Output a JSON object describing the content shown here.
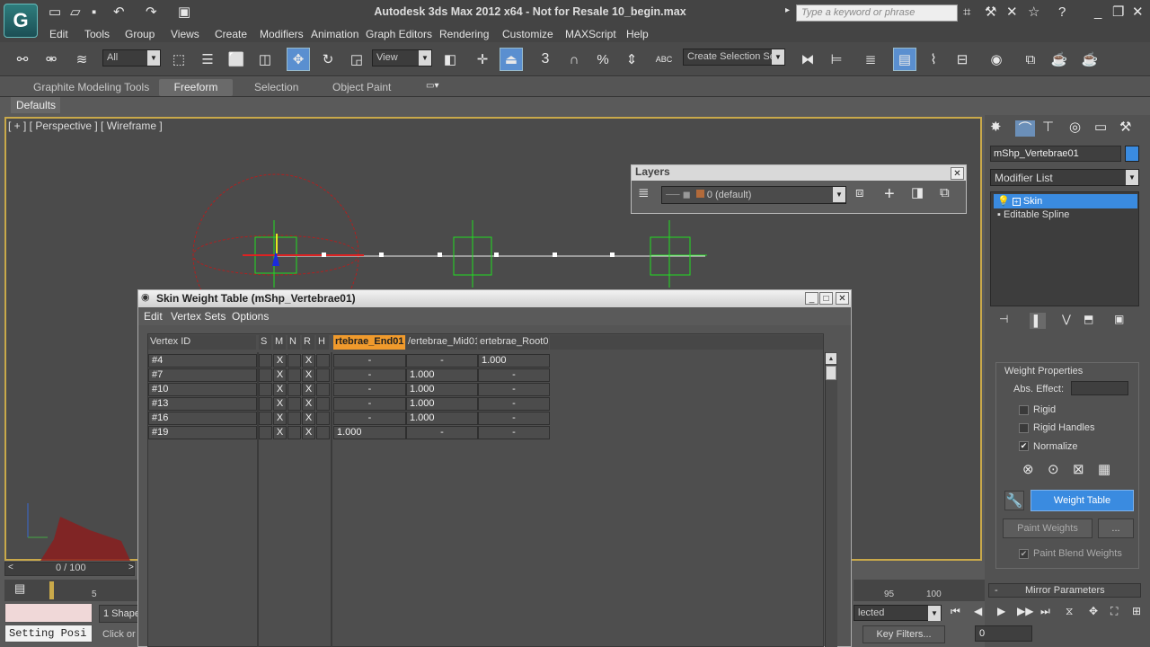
{
  "app": {
    "logo_glyph": "G",
    "title": "Autodesk 3ds Max  2012 x64  - Not for Resale   10_begin.max",
    "search_placeholder": "Type a keyword or phrase"
  },
  "menu": [
    "Edit",
    "Tools",
    "Group",
    "Views",
    "Create",
    "Modifiers",
    "Animation",
    "Graph Editors",
    "Rendering",
    "Customize",
    "MAXScript",
    "Help"
  ],
  "toolbar": {
    "selection_filter": "All",
    "ref_coord": "View",
    "named_selection": "Create Selection Se",
    "snap_3": "3",
    "snap_pct": "%",
    "abc": "ABC"
  },
  "ribbon": {
    "tabs": [
      "Graphite Modeling Tools",
      "Freeform",
      "Selection",
      "Object Paint"
    ],
    "active": "Freeform",
    "defaults": "Defaults"
  },
  "viewport": {
    "label": "[ + ] [ Perspective ] [ Wireframe ]",
    "accent": "#c9a94a"
  },
  "layers": {
    "title": "Layers",
    "current_layer": "0 (default)"
  },
  "command_panel": {
    "object_name": "mShp_Vertebrae01",
    "object_color": "#3a8be0",
    "modifier_list": "Modifier List",
    "stack": [
      "Skin",
      "Editable Spline"
    ],
    "weight_properties": "Weight Properties",
    "abs_effect": "Abs. Effect:",
    "rigid": "Rigid",
    "rigid_handles": "Rigid Handles",
    "normalize": "Normalize",
    "weight_table": "Weight Table",
    "paint_weights": "Paint Weights",
    "ellipsis": "...",
    "paint_blend": "Paint Blend Weights",
    "mirror_params": "Mirror Parameters",
    "minus": "-"
  },
  "skin_table": {
    "title": "Skin Weight Table (mShp_Vertebrae01)",
    "menu": [
      "Edit",
      "Vertex Sets",
      "Options"
    ],
    "headers": {
      "vertex_id": "Vertex ID",
      "s": "S",
      "m": "M",
      "n": "N",
      "r": "R",
      "h": "H"
    },
    "bones": [
      "rtebrae_End01",
      "/ertebrae_Mid01",
      "ertebrae_Root01"
    ],
    "rows": [
      {
        "id": "#4",
        "m": "X",
        "r": "X",
        "w": [
          "-",
          "-",
          "1.000"
        ]
      },
      {
        "id": "#7",
        "m": "X",
        "r": "X",
        "w": [
          "-",
          "1.000",
          "-"
        ]
      },
      {
        "id": "#10",
        "m": "X",
        "r": "X",
        "w": [
          "-",
          "1.000",
          "-"
        ]
      },
      {
        "id": "#13",
        "m": "X",
        "r": "X",
        "w": [
          "-",
          "1.000",
          "-"
        ]
      },
      {
        "id": "#16",
        "m": "X",
        "r": "X",
        "w": [
          "-",
          "1.000",
          "-"
        ]
      },
      {
        "id": "#19",
        "m": "X",
        "r": "X",
        "w": [
          "1.000",
          "-",
          "-"
        ]
      }
    ]
  },
  "bottom": {
    "frame": "0 / 100",
    "tick_5": "5",
    "tick_95": "95",
    "tick_100": "100",
    "shapes": "1 Shape",
    "click_or": "Click or",
    "status": "Setting Posi",
    "selected": "lected",
    "key_filters": "Key Filters...",
    "frame_field": "0"
  }
}
